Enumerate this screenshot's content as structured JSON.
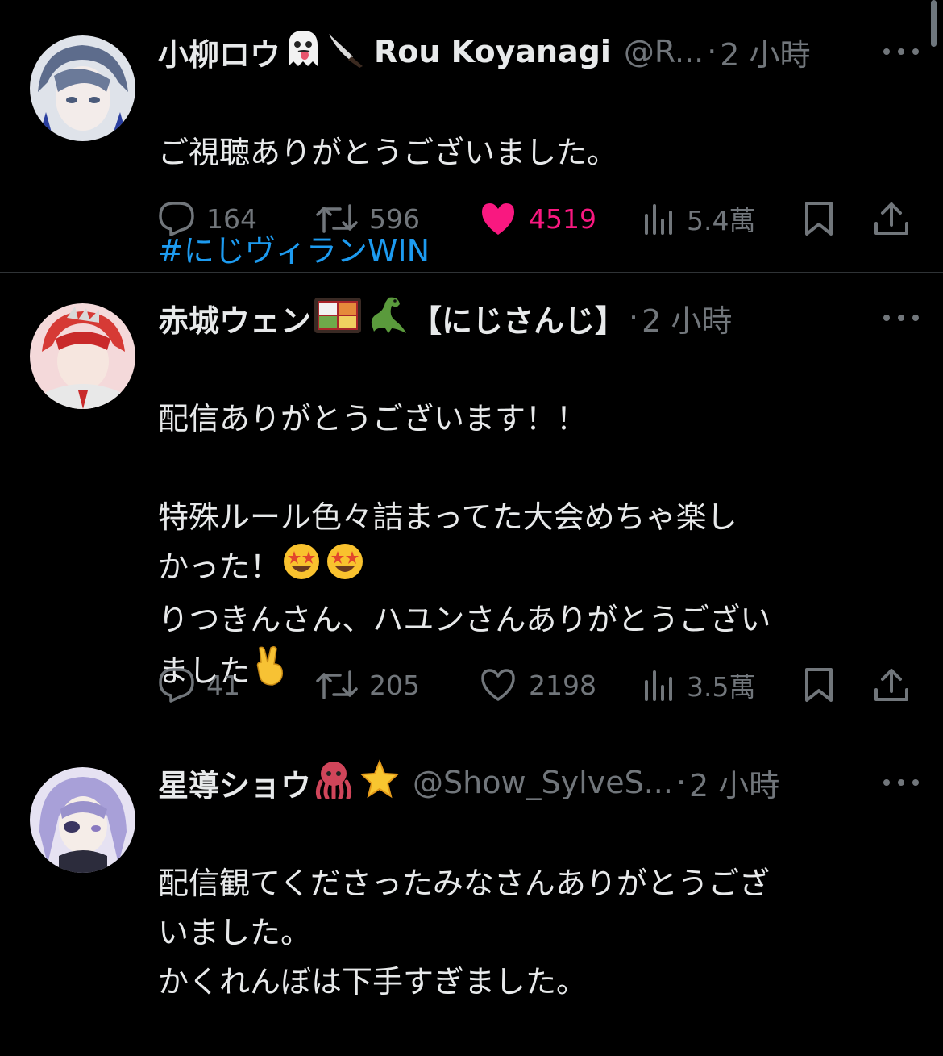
{
  "tweets": [
    {
      "name": "小柳ロウ",
      "name_suffix": "Rou Koyanagi",
      "name_emojis": [
        "ghost-face-icon",
        "knife-icon"
      ],
      "handle": "@R...",
      "time": "2 小時",
      "text": "ご視聴ありがとうございました。",
      "hashtag": "#にじヴィランWIN",
      "replies": "164",
      "retweets": "596",
      "likes": "4519",
      "liked": true,
      "views": "5.4萬"
    },
    {
      "name": "赤城ウェン",
      "name_suffix": "【にじさんじ】",
      "name_emojis": [
        "bento-icon",
        "dinosaur-icon"
      ],
      "handle": "",
      "time": "2 小時",
      "text": "配信ありがとうございます！！\n\n特殊ルール色々詰まってた大会めちゃ楽し\nかった！",
      "text2": "りつきんさん、ハユンさんありがとうござい\nました",
      "replies": "41",
      "retweets": "205",
      "likes": "2198",
      "liked": false,
      "views": "3.5萬"
    },
    {
      "name": "星導ショウ",
      "name_suffix": "",
      "name_emojis": [
        "octopus-icon",
        "star-icon"
      ],
      "handle": "@Show_SylveS...",
      "time": "2 小時",
      "text": "配信観てくださったみなさんありがとうござ\nいました。\nかくれんぼは下手すぎました。"
    }
  ],
  "separator": "·",
  "colors": {
    "background": "#000000",
    "text": "#e7e9ea",
    "muted": "#71767b",
    "link": "#1d9bf0",
    "like": "#f91880",
    "divider": "#2f3336"
  }
}
